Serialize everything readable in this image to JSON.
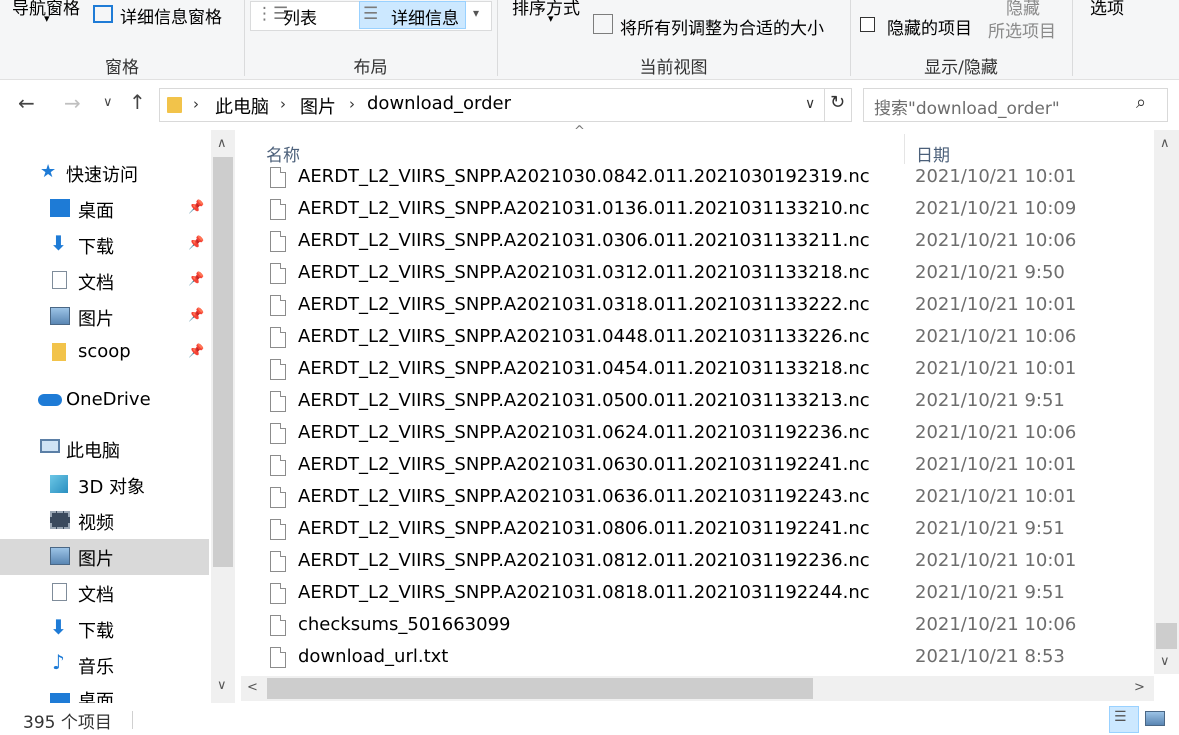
{
  "ribbon": {
    "nav_pane_label": "导航窗格",
    "details_pane_label": "详细信息窗格",
    "group_panes": "窗格",
    "list_label": "列表",
    "details_label": "详细信息",
    "group_layout": "布局",
    "sort_label": "排序方式",
    "fit_columns_label": "将所有列调整为合适的大小",
    "group_current_view": "当前视图",
    "hidden_items_label": "隐藏的项目",
    "hide_label": "隐藏",
    "hide_selected_label": "所选项目",
    "group_show_hide": "显示/隐藏",
    "options_label": "选项"
  },
  "address": {
    "crumbs": [
      "此电脑",
      "图片",
      "download_order"
    ],
    "search_placeholder": "搜索\"download_order\""
  },
  "nav_pane": {
    "items": [
      {
        "label": "快速访问",
        "icon": "star-icon",
        "pinned": false
      },
      {
        "label": "桌面",
        "icon": "desktop-icon",
        "pinned": true
      },
      {
        "label": "下载",
        "icon": "download-arrow-icon",
        "pinned": true
      },
      {
        "label": "文档",
        "icon": "document-icon",
        "pinned": true
      },
      {
        "label": "图片",
        "icon": "pictures-icon",
        "pinned": true
      },
      {
        "label": "scoop",
        "icon": "folder-icon",
        "pinned": true
      },
      {
        "label": "OneDrive",
        "icon": "cloud-icon",
        "pinned": false
      },
      {
        "label": "此电脑",
        "icon": "computer-icon",
        "pinned": false
      },
      {
        "label": "3D 对象",
        "icon": "3d-objects-icon",
        "pinned": false
      },
      {
        "label": "视频",
        "icon": "video-icon",
        "pinned": false
      },
      {
        "label": "图片",
        "icon": "pictures-icon",
        "pinned": false,
        "selected": true
      },
      {
        "label": "文档",
        "icon": "document-icon",
        "pinned": false
      },
      {
        "label": "下载",
        "icon": "download-arrow-icon",
        "pinned": false
      },
      {
        "label": "音乐",
        "icon": "music-icon",
        "pinned": false
      },
      {
        "label": "桌面",
        "icon": "desktop-icon",
        "pinned": false
      }
    ]
  },
  "file_list": {
    "columns": {
      "name": "名称",
      "date": "日期"
    },
    "files": [
      {
        "name": "AERDT_L2_VIIRS_SNPP.A2021030.0842.011.2021030192319.nc",
        "date": "2021/10/21 10:01"
      },
      {
        "name": "AERDT_L2_VIIRS_SNPP.A2021031.0136.011.2021031133210.nc",
        "date": "2021/10/21 10:09"
      },
      {
        "name": "AERDT_L2_VIIRS_SNPP.A2021031.0306.011.2021031133211.nc",
        "date": "2021/10/21 10:06"
      },
      {
        "name": "AERDT_L2_VIIRS_SNPP.A2021031.0312.011.2021031133218.nc",
        "date": "2021/10/21 9:50"
      },
      {
        "name": "AERDT_L2_VIIRS_SNPP.A2021031.0318.011.2021031133222.nc",
        "date": "2021/10/21 10:01"
      },
      {
        "name": "AERDT_L2_VIIRS_SNPP.A2021031.0448.011.2021031133226.nc",
        "date": "2021/10/21 10:06"
      },
      {
        "name": "AERDT_L2_VIIRS_SNPP.A2021031.0454.011.2021031133218.nc",
        "date": "2021/10/21 10:01"
      },
      {
        "name": "AERDT_L2_VIIRS_SNPP.A2021031.0500.011.2021031133213.nc",
        "date": "2021/10/21 9:51"
      },
      {
        "name": "AERDT_L2_VIIRS_SNPP.A2021031.0624.011.2021031192236.nc",
        "date": "2021/10/21 10:06"
      },
      {
        "name": "AERDT_L2_VIIRS_SNPP.A2021031.0630.011.2021031192241.nc",
        "date": "2021/10/21 10:01"
      },
      {
        "name": "AERDT_L2_VIIRS_SNPP.A2021031.0636.011.2021031192243.nc",
        "date": "2021/10/21 10:01"
      },
      {
        "name": "AERDT_L2_VIIRS_SNPP.A2021031.0806.011.2021031192241.nc",
        "date": "2021/10/21 9:51"
      },
      {
        "name": "AERDT_L2_VIIRS_SNPP.A2021031.0812.011.2021031192236.nc",
        "date": "2021/10/21 10:01"
      },
      {
        "name": "AERDT_L2_VIIRS_SNPP.A2021031.0818.011.2021031192244.nc",
        "date": "2021/10/21 9:51"
      },
      {
        "name": "checksums_501663099",
        "date": "2021/10/21 10:06"
      },
      {
        "name": "download_url.txt",
        "date": "2021/10/21 8:53"
      }
    ]
  },
  "status": {
    "item_count": "395 个项目"
  },
  "colors": {
    "selected_nav": "#d9d9d9",
    "toggle_active": "#cce8ff",
    "header_text": "#4c607a",
    "folder_yellow": "#f2c34a",
    "accent_blue": "#1e7bd6"
  }
}
